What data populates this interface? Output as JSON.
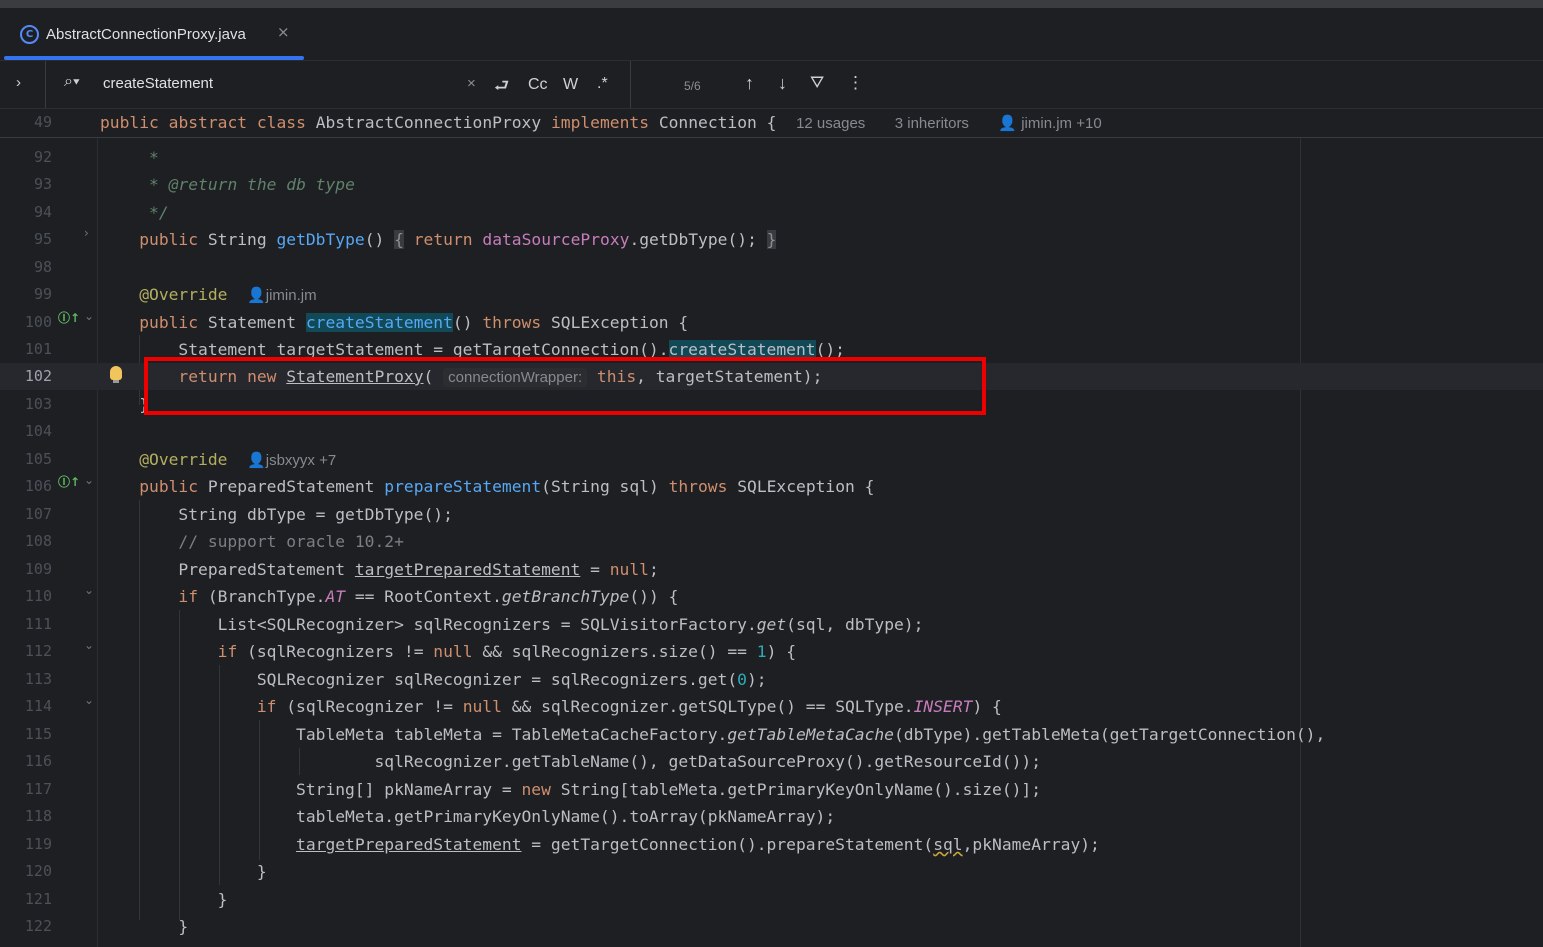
{
  "tab": {
    "title": "AbstractConnectionProxy.java",
    "icon": "java-class-icon",
    "close": "×"
  },
  "find": {
    "expand": "›",
    "query": "createStatement",
    "clear": "×",
    "newline": "⮐",
    "match_case": "Cc",
    "words": "W",
    "regex": ".*",
    "count": "5/6",
    "up": "↑",
    "down": "↓",
    "filter": "⛛",
    "more": "⋮"
  },
  "sticky": {
    "num": "49",
    "public": "public",
    "abstract": "abstract",
    "class": "class",
    "name": "AbstractConnectionProxy",
    "implements": "implements",
    "iface": "Connection",
    "brace": "{",
    "usages": "12 usages",
    "inheritors": "3 inheritors",
    "authors": "jimin.jm +10"
  },
  "lines": [
    {
      "n": "92"
    },
    {
      "n": "93"
    },
    {
      "n": "94"
    },
    {
      "n": "95"
    },
    {
      "n": "98"
    },
    {
      "n": "99"
    },
    {
      "n": "100"
    },
    {
      "n": "101"
    },
    {
      "n": "102"
    },
    {
      "n": "103"
    },
    {
      "n": "104"
    },
    {
      "n": "105"
    },
    {
      "n": "106"
    },
    {
      "n": "107"
    },
    {
      "n": "108"
    },
    {
      "n": "109"
    },
    {
      "n": "110"
    },
    {
      "n": "111"
    },
    {
      "n": "112"
    },
    {
      "n": "113"
    },
    {
      "n": "114"
    },
    {
      "n": "115"
    },
    {
      "n": "116"
    },
    {
      "n": "117"
    },
    {
      "n": "118"
    },
    {
      "n": "119"
    },
    {
      "n": "120"
    },
    {
      "n": "121"
    },
    {
      "n": "122"
    }
  ],
  "code": {
    "l92_star": "     *",
    "l93_pre": "     * ",
    "l93_tag": "@return",
    "l93_rest": " the db type",
    "l94": "     */",
    "l95_pre": "    ",
    "l95_public": "public",
    "l95_type": " String ",
    "l95_fn": "getDbType",
    "l95_paren": "() ",
    "l95_ob": "{",
    "l95_sp": " ",
    "l95_return": "return",
    "l95_sp2": " ",
    "l95_field": "dataSourceProxy",
    "l95_rest": ".getDbType(); ",
    "l95_cb": "}",
    "l99_pre": "    ",
    "l99_ann": "@Override",
    "l99_author": "jimin.jm",
    "l100_pre": "    ",
    "l100_public": "public",
    "l100_type": " Statement ",
    "l100_fn": "createStatement",
    "l100_paren": "() ",
    "l100_throws": "throws",
    "l100_rest": " SQLException {",
    "l101_pre": "        Statement targetStatement = getTargetConnection().",
    "l101_hl": "createStatement",
    "l101_rest": "();",
    "l102_pre": "        ",
    "l102_return": "return",
    "l102_sp": " ",
    "l102_new": "new",
    "l102_sp2": " ",
    "l102_cls": "StatementProxy",
    "l102_open": "( ",
    "l102_hint": "connectionWrapper:",
    "l102_sp3": " ",
    "l102_this": "this",
    "l102_rest": ", targetStatement);",
    "l103": "    }",
    "l105_pre": "    ",
    "l105_ann": "@Override",
    "l105_author": "jsbxyyx +7",
    "l106_pre": "    ",
    "l106_public": "public",
    "l106_type": " PreparedStatement ",
    "l106_fn": "prepareStatement",
    "l106_args": "(String sql) ",
    "l106_throws": "throws",
    "l106_rest": " SQLException {",
    "l107": "        String dbType = getDbType();",
    "l108": "        // support oracle 10.2+",
    "l109_pre": "        PreparedStatement ",
    "l109_var": "targetPreparedStatement",
    "l109_eq": " = ",
    "l109_null": "null",
    "l109_end": ";",
    "l110_pre": "        ",
    "l110_if": "if",
    "l110_a": " (BranchType.",
    "l110_at": "AT",
    "l110_b": " == RootContext.",
    "l110_m": "getBranchType",
    "l110_c": "()) {",
    "l111_pre": "            List<SQLRecognizer> sqlRecognizers = SQLVisitorFactory.",
    "l111_get": "get",
    "l111_rest": "(sql, dbType);",
    "l112_pre": "            ",
    "l112_if": "if",
    "l112_a": " (sqlRecognizers != ",
    "l112_null": "null",
    "l112_b": " && sqlRecognizers.size() == ",
    "l112_one": "1",
    "l112_c": ") {",
    "l113_pre": "                SQLRecognizer sqlRecognizer = sqlRecognizers.get(",
    "l113_zero": "0",
    "l113_rest": ");",
    "l114_pre": "                ",
    "l114_if": "if",
    "l114_a": " (sqlRecognizer != ",
    "l114_null": "null",
    "l114_b": " && sqlRecognizer.getSQLType() == SQLType.",
    "l114_ins": "INSERT",
    "l114_c": ") {",
    "l115_pre": "                    TableMeta tableMeta = TableMetaCacheFactory.",
    "l115_m": "getTableMetaCache",
    "l115_rest": "(dbType).getTableMeta(getTargetConnection(),",
    "l116": "                            sqlRecognizer.getTableName(), getDataSourceProxy().getResourceId());",
    "l117_pre": "                    String[] pkNameArray = ",
    "l117_new": "new",
    "l117_rest": " String[tableMeta.getPrimaryKeyOnlyName().size()];",
    "l118": "                    tableMeta.getPrimaryKeyOnlyName().toArray(pkNameArray);",
    "l119_pre": "                    ",
    "l119_var": "targetPreparedStatement",
    "l119_mid": " = getTargetConnection().prepareStatement(",
    "l119_sql": "sql",
    "l119_rest": ",pkNameArray);",
    "l120": "                }",
    "l121": "            }",
    "l122": "        }"
  },
  "colors": {
    "accent": "#3574f0",
    "highlight_box": "#ee0000",
    "keyword": "#cf8e6d",
    "function": "#56a8f5"
  }
}
